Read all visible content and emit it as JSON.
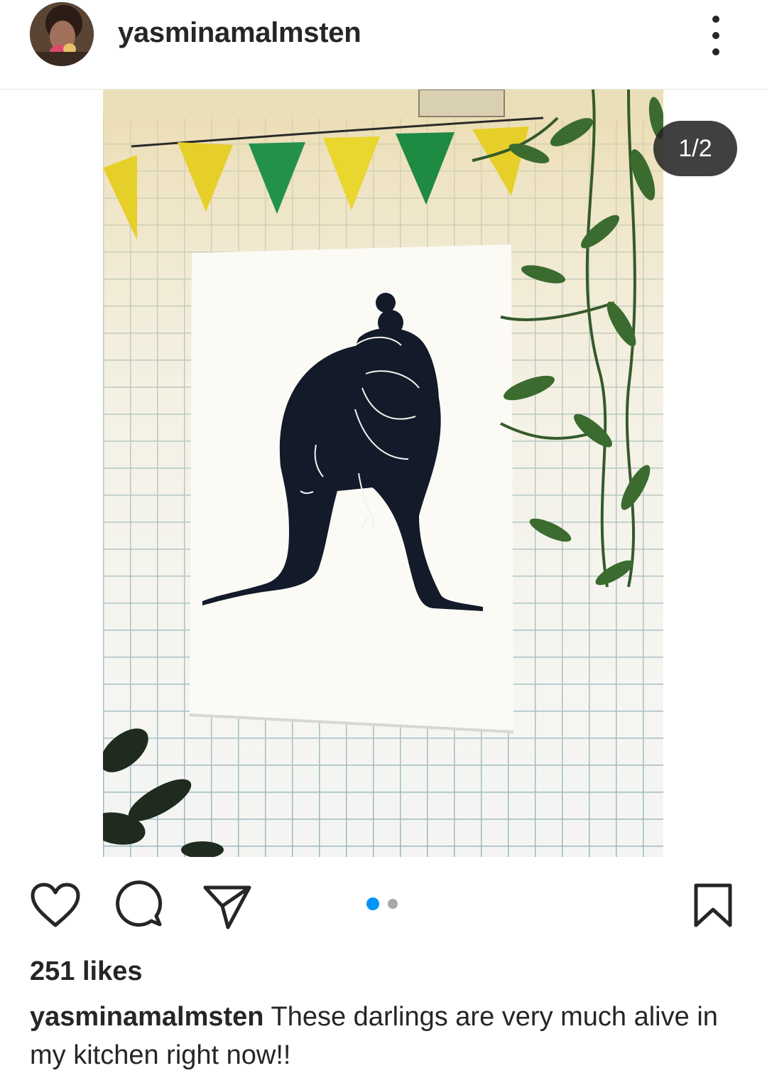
{
  "post": {
    "username": "yasminamalmsten",
    "media_counter": "1/2",
    "carousel": {
      "total": 2,
      "active_index": 0
    },
    "likes_text": "251 likes",
    "caption_user": "yasminamalmsten",
    "caption_text": "These darlings are very much alive in my kitchen right now!!"
  },
  "icons": {
    "more": "more-vertical-icon",
    "like": "heart-icon",
    "comment": "comment-icon",
    "share": "send-icon",
    "save": "bookmark-icon"
  },
  "colors": {
    "text": "#262626",
    "accent_dot": "#0095f6",
    "inactive_dot": "#a8a8a8",
    "counter_bg": "#262626"
  }
}
